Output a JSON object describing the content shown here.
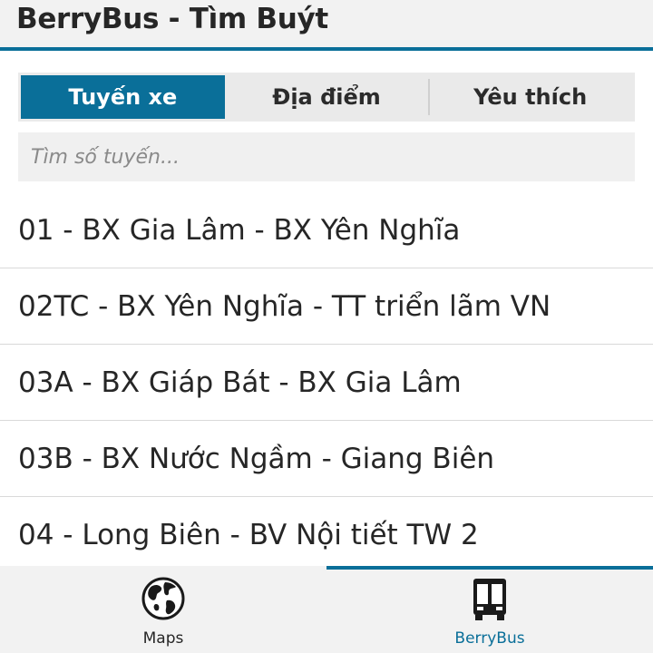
{
  "app": {
    "title": "BerryBus - Tìm Buýt"
  },
  "colors": {
    "accent": "#0a6f99",
    "background": "#ffffff",
    "bar": "#f2f2f2"
  },
  "segments": [
    {
      "label": "Tuyến xe",
      "active": true
    },
    {
      "label": "Địa điểm",
      "active": false
    },
    {
      "label": "Yêu thích",
      "active": false
    }
  ],
  "search": {
    "placeholder": "Tìm số tuyến...",
    "value": ""
  },
  "routes": [
    "01 - BX Gia Lâm - BX Yên Nghĩa",
    "02TC - BX Yên Nghĩa - TT triển lãm VN",
    "03A - BX Giáp Bát - BX Gia Lâm",
    "03B - BX Nước Ngầm - Giang Biên",
    "04 - Long Biên - BV Nội tiết TW 2"
  ],
  "tabs": [
    {
      "label": "Maps",
      "icon": "globe-icon",
      "active": false
    },
    {
      "label": "BerryBus",
      "icon": "bus-icon",
      "active": true
    }
  ]
}
